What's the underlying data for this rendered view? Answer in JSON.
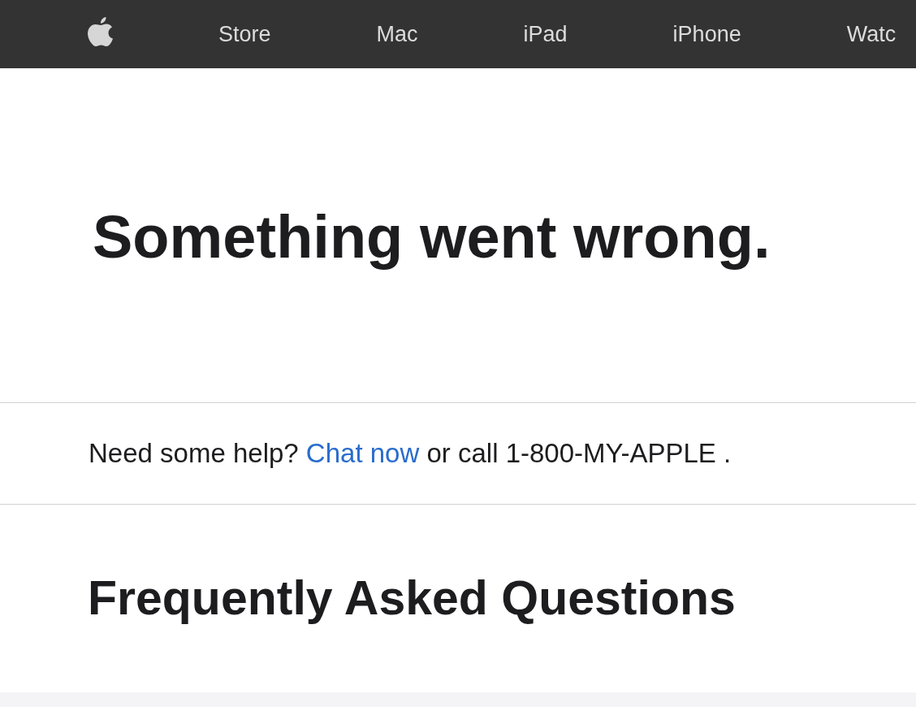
{
  "nav": {
    "items": [
      "Store",
      "Mac",
      "iPad",
      "iPhone",
      "Watc"
    ]
  },
  "hero": {
    "title": "Something went wrong."
  },
  "help": {
    "prefix": "Need some help?",
    "link": "Chat now",
    "suffix": "or call 1-800-MY-APPLE ."
  },
  "faq": {
    "title": "Frequently Asked Questions"
  }
}
